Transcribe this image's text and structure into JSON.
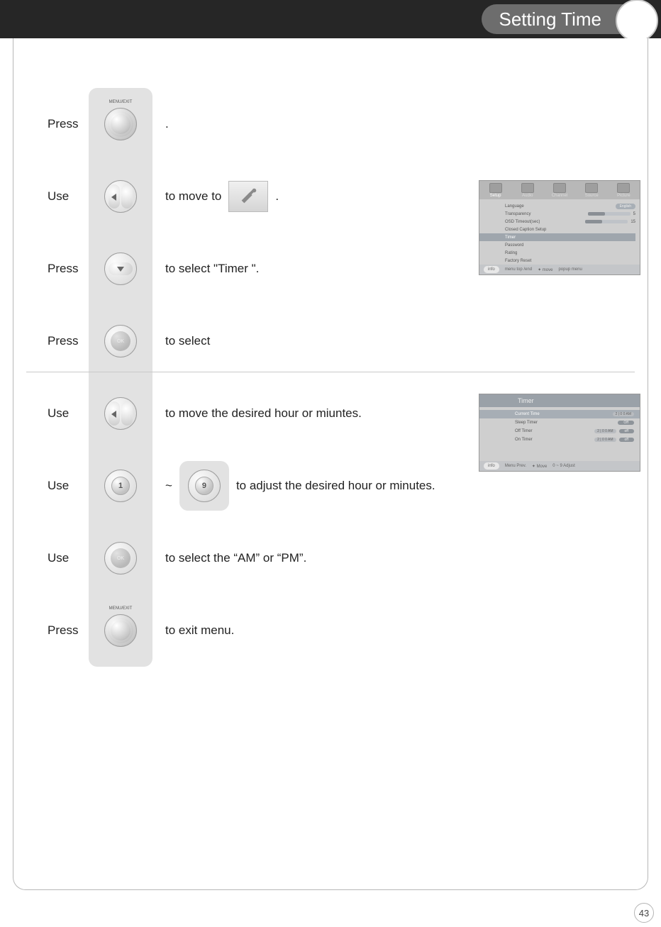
{
  "header": {
    "title": "Setting Time"
  },
  "page_number": "43",
  "steps": [
    {
      "verb": "Press",
      "icon": "menu-exit",
      "desc_after": "."
    },
    {
      "verb": "Use",
      "icon": "left-right",
      "desc_before": "to move to",
      "desc_after": "."
    },
    {
      "verb": "Press",
      "icon": "down",
      "desc_before": "to select \"Timer \"."
    },
    {
      "verb": "Press",
      "icon": "ok",
      "desc_before": "to select"
    },
    {
      "verb": "Use",
      "icon": "left-right",
      "desc_before": "to move the desired hour or miuntes."
    },
    {
      "verb": "Use",
      "icon": "num1",
      "num_from": "1",
      "num_to": "9",
      "tilde": "~",
      "desc_after": "to adjust the desired hour or minutes."
    },
    {
      "verb": "Use",
      "icon": "ok",
      "desc_before": "to select the “AM” or “PM”."
    },
    {
      "verb": "Press",
      "icon": "menu-exit",
      "desc_before": "to exit menu."
    }
  ],
  "osd1": {
    "tabs": [
      "Setup",
      "Audio",
      "Channel",
      "Source",
      "Picture"
    ],
    "rows": [
      {
        "label": "Language",
        "value_pill": "English"
      },
      {
        "label": "Transparency",
        "value_num": "5"
      },
      {
        "label": "OSD Timeout(sec)",
        "value_num": "15"
      },
      {
        "label": "Closed Caption Setup"
      },
      {
        "label": "Timer",
        "hl": true
      },
      {
        "label": "Password"
      },
      {
        "label": "Rating"
      },
      {
        "label": "Factory Reset"
      }
    ],
    "footer": {
      "info": "info",
      "items": [
        "menu  top /end",
        "move",
        "popup menu"
      ]
    }
  },
  "osd2": {
    "title": "Timer",
    "rows": [
      {
        "label": "Current Time",
        "value": "2 | 0 0 AM",
        "hl": true
      },
      {
        "label": "Sleep Timer",
        "chip": "Off"
      },
      {
        "label": "Off Timer",
        "value": "2 | 0 0 AM",
        "chip": "off"
      },
      {
        "label": "On Timer",
        "value": "2 | 0 0 AM",
        "chip": "off"
      }
    ],
    "footer": {
      "info": "info",
      "items": [
        "Menu  Prev.",
        "Move",
        "0 ~ 9  Adjust"
      ]
    }
  }
}
